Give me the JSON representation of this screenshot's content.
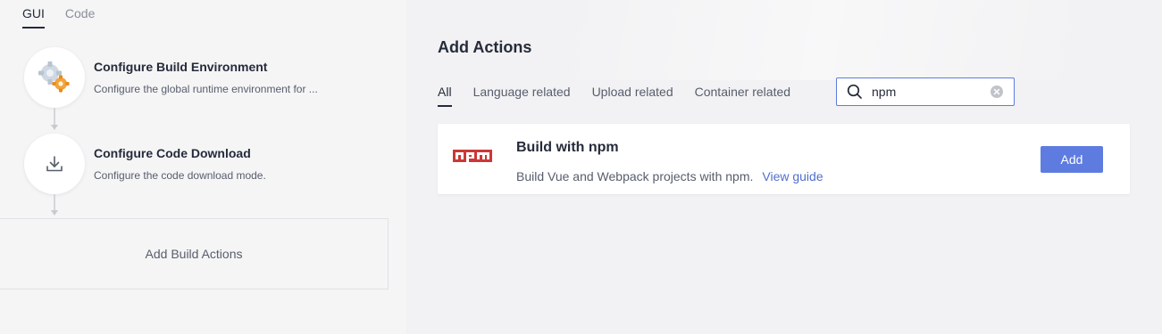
{
  "left_tabs": [
    "GUI",
    "Code"
  ],
  "steps": [
    {
      "title": "Configure Build Environment",
      "desc": "Configure the global runtime environment for ..."
    },
    {
      "title": "Configure Code Download",
      "desc": "Configure the code download mode."
    }
  ],
  "add_build_actions": "Add Build Actions",
  "panel": {
    "title": "Add Actions",
    "filters": [
      "All",
      "Language related",
      "Upload related",
      "Container related"
    ],
    "search_value": "npm"
  },
  "card": {
    "logo_text": "npm",
    "title": "Build with npm",
    "desc": "Build Vue and Webpack projects with npm.",
    "guide": "View guide",
    "add": "Add"
  },
  "colors": {
    "accent": "#5e7ce0",
    "link": "#526ecc",
    "npm": "#cb3837"
  },
  "icons": [
    "gear-icon",
    "download-icon",
    "search-icon",
    "clear-icon",
    "npm-logo-icon"
  ]
}
